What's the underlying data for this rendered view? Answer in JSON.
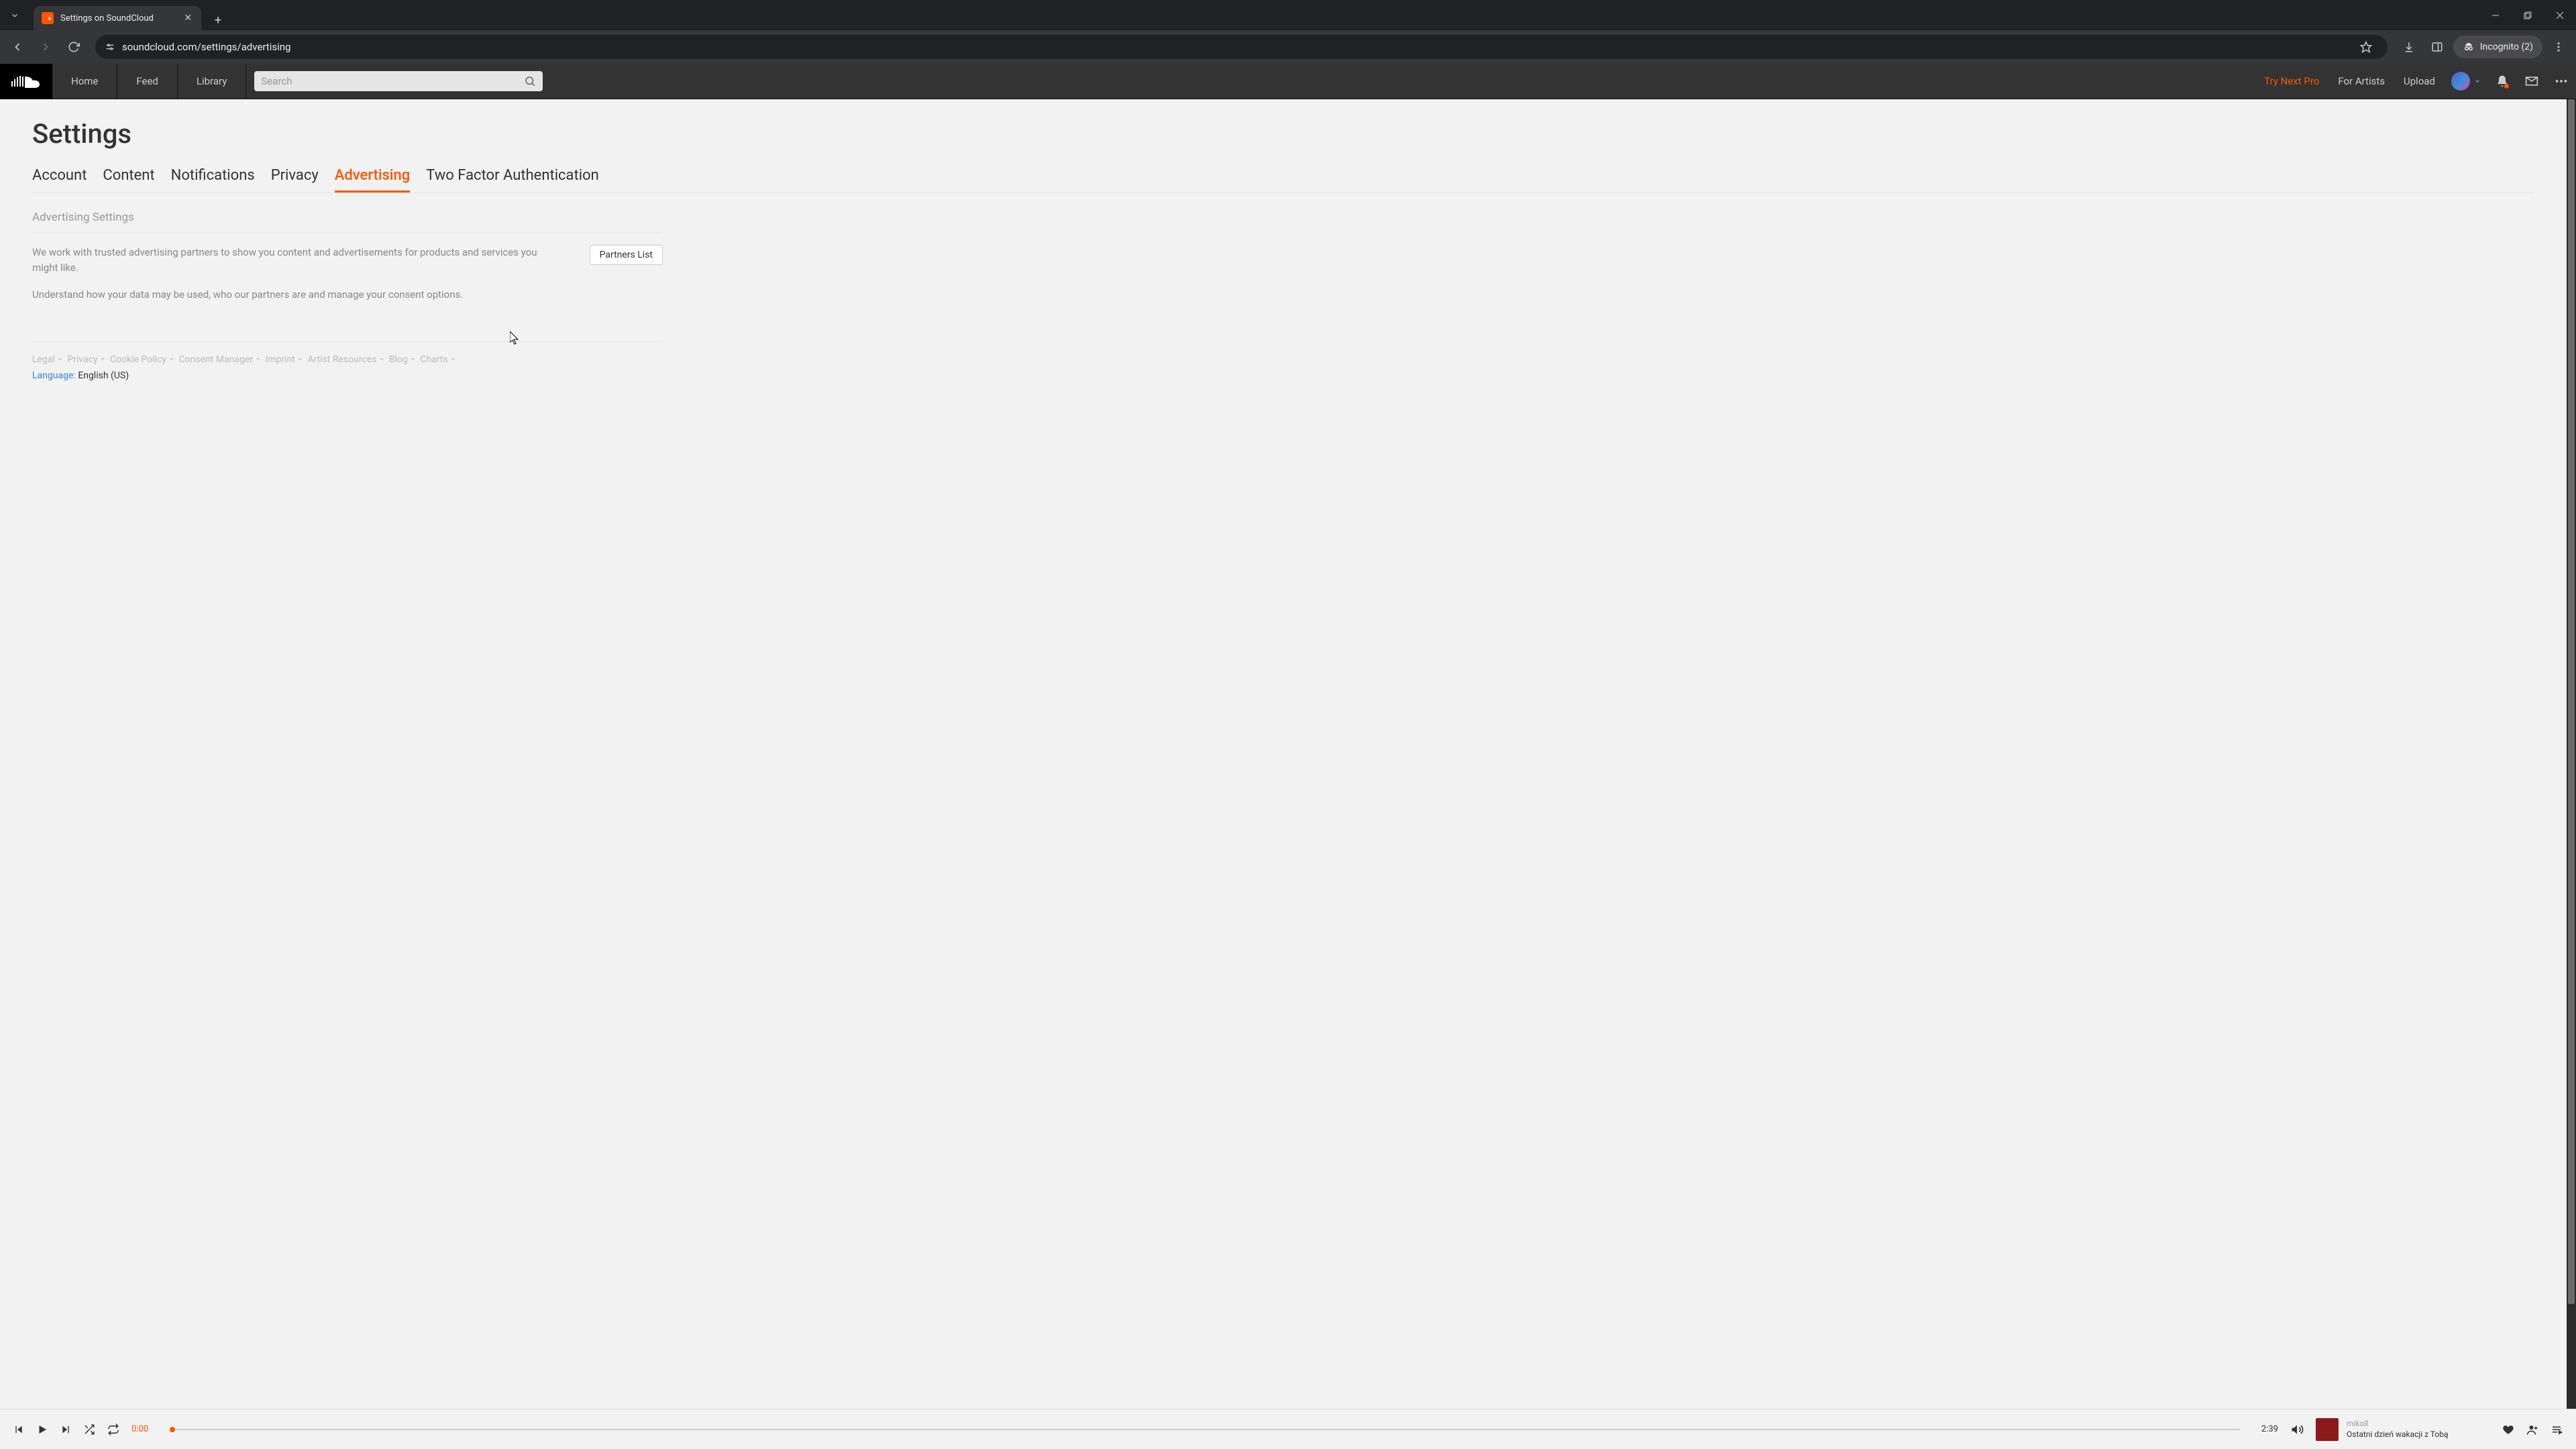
{
  "browser": {
    "tab_title": "Settings on SoundCloud",
    "url": "soundcloud.com/settings/advertising",
    "incognito_label": "Incognito (2)"
  },
  "header": {
    "nav": {
      "home": "Home",
      "feed": "Feed",
      "library": "Library"
    },
    "search_placeholder": "Search",
    "try": "Try Next Pro",
    "artists": "For Artists",
    "upload": "Upload"
  },
  "page": {
    "title": "Settings",
    "tabs": {
      "account": "Account",
      "content": "Content",
      "notifications": "Notifications",
      "privacy": "Privacy",
      "advertising": "Advertising",
      "twofa": "Two Factor Authentication"
    },
    "section_title": "Advertising Settings",
    "para1": "We work with trusted advertising partners to show you content and advertisements for products and services you might like.",
    "para2": "Understand how your data may be used, who our partners are and manage your consent options.",
    "partners_btn": "Partners List",
    "footer": {
      "legal": "Legal",
      "privacy": "Privacy",
      "cookie": "Cookie Policy",
      "consent": "Consent Manager",
      "imprint": "Imprint",
      "artist_res": "Artist Resources",
      "blog": "Blog",
      "charts": "Charts"
    },
    "language_label": "Language:",
    "language_value": "English (US)"
  },
  "player": {
    "elapsed": "0:00",
    "duration": "2:39",
    "artist": "mikoll",
    "track": "Ostatni dzień wakacji z Tobą"
  }
}
